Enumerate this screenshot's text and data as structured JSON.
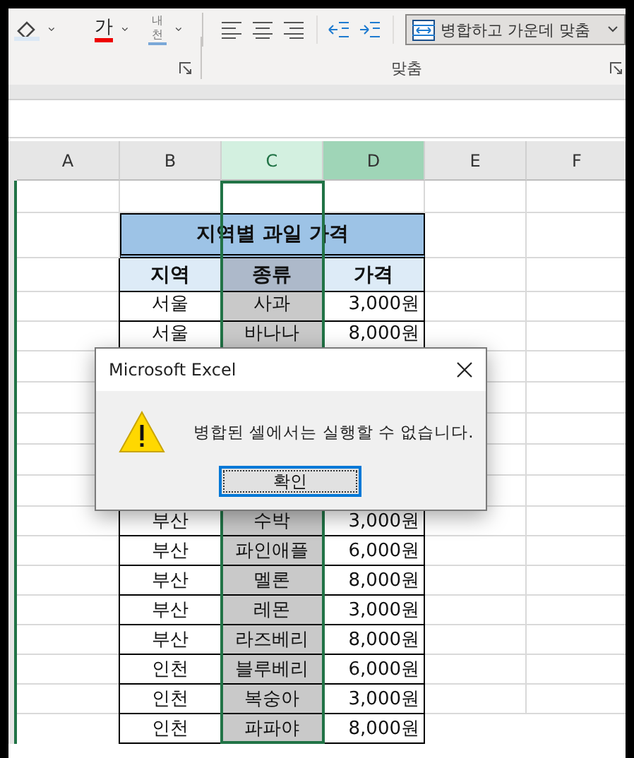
{
  "ribbon": {
    "font_color_label": "가",
    "phonetic_label": "내천",
    "merge_button": "병합하고 가운데 맞춤",
    "group_label": "맞춤"
  },
  "columns": [
    {
      "label": "A",
      "selected": false,
      "active": false
    },
    {
      "label": "B",
      "selected": false,
      "active": false
    },
    {
      "label": "C",
      "selected": true,
      "active": false
    },
    {
      "label": "D",
      "selected": false,
      "active": true
    },
    {
      "label": "E",
      "selected": false,
      "active": false
    },
    {
      "label": "F",
      "selected": false,
      "active": false
    }
  ],
  "table": {
    "title": "지역별 과일 가격",
    "headers": [
      "지역",
      "종류",
      "가격"
    ],
    "rows_above_dialog": [
      {
        "region": "서울",
        "fruit": "사과",
        "price": "3,000원"
      },
      {
        "region": "서울",
        "fruit": "바나나",
        "price": "8,000원"
      }
    ],
    "rows_below_dialog": [
      {
        "region": "부산",
        "fruit": "수박",
        "price": "3,000원"
      },
      {
        "region": "부산",
        "fruit": "파인애플",
        "price": "6,000원"
      },
      {
        "region": "부산",
        "fruit": "멜론",
        "price": "8,000원"
      },
      {
        "region": "부산",
        "fruit": "레몬",
        "price": "3,000원"
      },
      {
        "region": "부산",
        "fruit": "라즈베리",
        "price": "8,000원"
      },
      {
        "region": "인천",
        "fruit": "블루베리",
        "price": "6,000원"
      },
      {
        "region": "인천",
        "fruit": "복숭아",
        "price": "3,000원"
      },
      {
        "region": "인천",
        "fruit": "파파야",
        "price": "8,000원"
      }
    ]
  },
  "dialog": {
    "title": "Microsoft Excel",
    "message": "병합된 셀에서는 실행할 수 없습니다.",
    "button": "확인"
  }
}
